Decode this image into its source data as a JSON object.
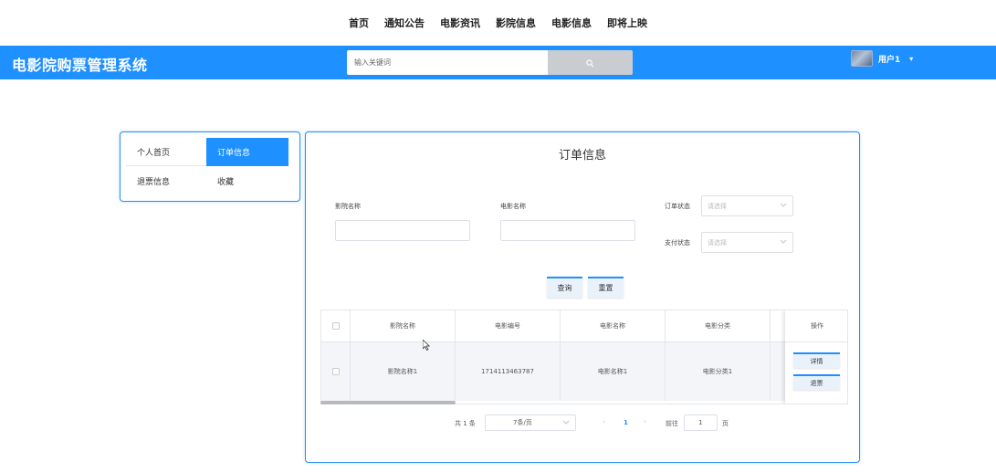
{
  "topnav": {
    "items": [
      "首页",
      "通知公告",
      "电影资讯",
      "影院信息",
      "电影信息",
      "即将上映"
    ]
  },
  "header": {
    "brand": "电影院购票管理系统",
    "search_placeholder": "输入关键词",
    "username": "用户1",
    "accent_color": "#1e90ff"
  },
  "sidebar": {
    "items": [
      {
        "label": "个人首页"
      },
      {
        "label": "订单信息"
      },
      {
        "label": "退票信息"
      },
      {
        "label": "收藏"
      }
    ],
    "active": "订单信息"
  },
  "main": {
    "title": "订单信息",
    "filters": {
      "cinema_label": "影院名称",
      "movie_label": "电影名称",
      "order_status_label": "订单状态",
      "order_status_placeholder": "请选择",
      "pay_status_label": "支付状态",
      "pay_status_placeholder": "请选择"
    },
    "buttons": {
      "query": "查询",
      "reset": "重置"
    },
    "table": {
      "columns": [
        "影院名称",
        "电影编号",
        "电影名称",
        "电影分类",
        "操作"
      ],
      "rows": [
        {
          "cinema": "影院名称1",
          "movie_no": "1714113463787",
          "movie_name": "电影名称1",
          "category": "电影分类1",
          "actions": [
            "详情",
            "退票"
          ]
        }
      ]
    },
    "pagination": {
      "total": "共 1 条",
      "page_size": "7条/页",
      "current_page": "1",
      "goto_label": "前往",
      "goto_value": "1",
      "page_unit": "页"
    }
  }
}
